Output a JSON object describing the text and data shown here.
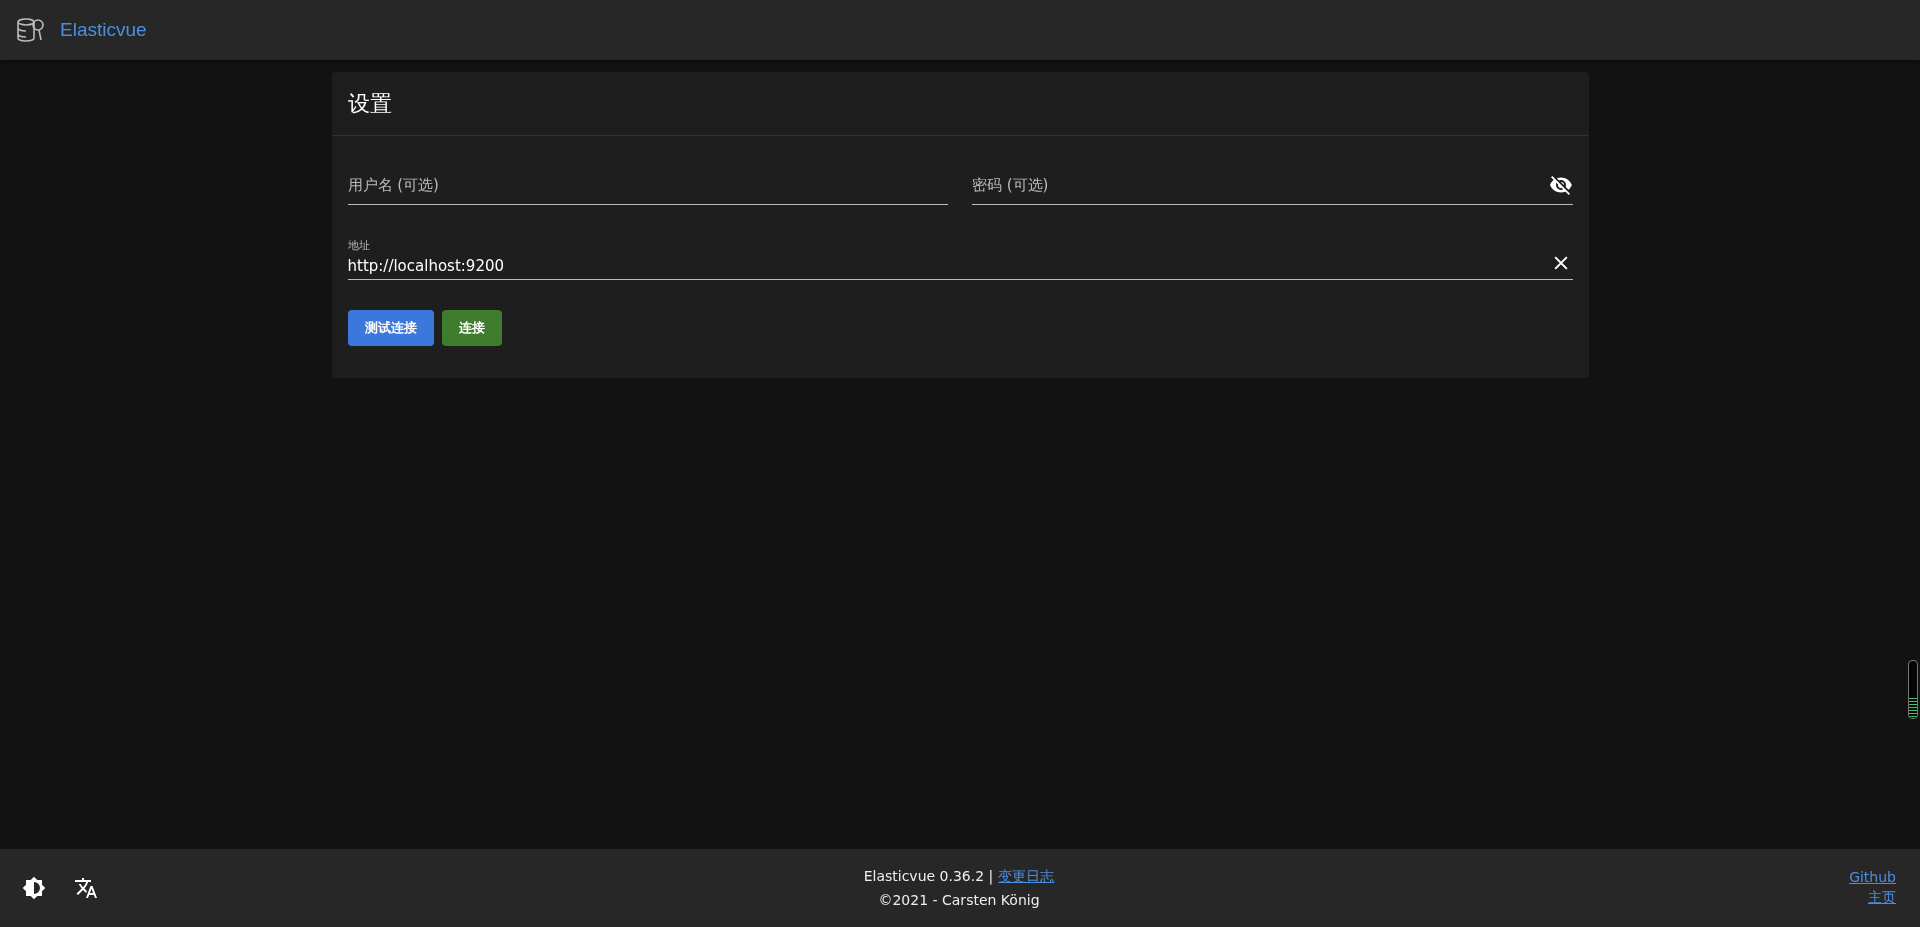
{
  "app_bar": {
    "title": "Elasticvue"
  },
  "settings_card": {
    "title": "设置",
    "username": {
      "placeholder": "用户名 (可选)"
    },
    "password": {
      "placeholder": "密码 (可选)",
      "visible": false
    },
    "address": {
      "label": "地址",
      "value": "http://localhost:9200"
    },
    "buttons": [
      {
        "label": "测试连接",
        "kind": "primary"
      },
      {
        "label": "连接",
        "kind": "success"
      }
    ]
  },
  "side_meter": {
    "level": 0.35
  },
  "footer": {
    "version": "Elasticvue 0.36.2 |",
    "changelog_link": "变更日志",
    "copyright": "©2021 - Carsten König",
    "links": [
      "Github",
      "主页"
    ]
  }
}
